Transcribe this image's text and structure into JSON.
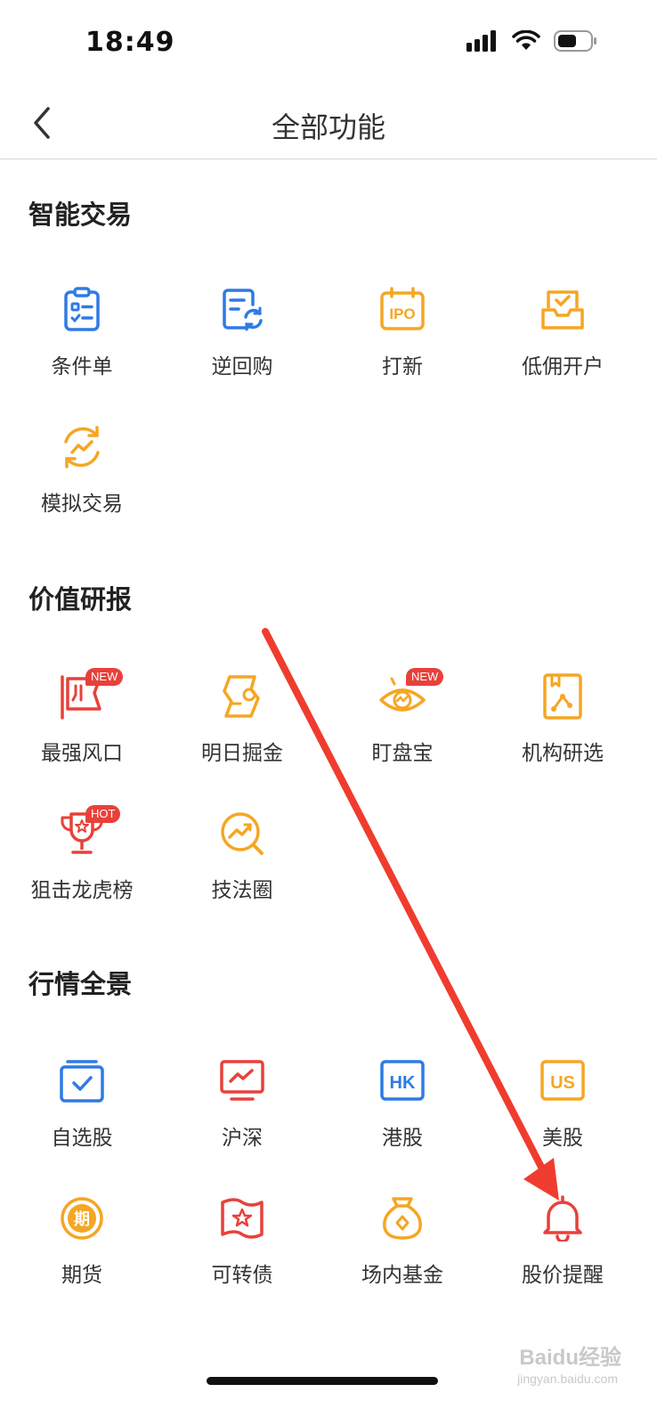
{
  "status": {
    "time": "18:49"
  },
  "header": {
    "title": "全部功能"
  },
  "sections": [
    {
      "title": "智能交易",
      "items": [
        {
          "label": "条件单",
          "icon": "clipboard-list-icon"
        },
        {
          "label": "逆回购",
          "icon": "document-refresh-icon"
        },
        {
          "label": "打新",
          "icon": "ipo-calendar-icon",
          "icon_text": "IPO"
        },
        {
          "label": "低佣开户",
          "icon": "open-account-icon"
        },
        {
          "label": "模拟交易",
          "icon": "simulated-trading-icon"
        }
      ]
    },
    {
      "title": "价值研报",
      "items": [
        {
          "label": "最强风口",
          "icon": "flag-icon",
          "badge": "NEW"
        },
        {
          "label": "明日掘金",
          "icon": "gold-coin-icon"
        },
        {
          "label": "盯盘宝",
          "icon": "eye-icon",
          "badge": "NEW"
        },
        {
          "label": "机构研选",
          "icon": "research-book-icon"
        },
        {
          "label": "狙击龙虎榜",
          "icon": "trophy-icon",
          "badge": "HOT"
        },
        {
          "label": "技法圈",
          "icon": "trend-magnifier-icon"
        }
      ]
    },
    {
      "title": "行情全景",
      "items": [
        {
          "label": "自选股",
          "icon": "watchlist-icon"
        },
        {
          "label": "沪深",
          "icon": "monitor-chart-icon"
        },
        {
          "label": "港股",
          "icon": "hk-icon",
          "icon_text": "HK"
        },
        {
          "label": "美股",
          "icon": "us-icon",
          "icon_text": "US"
        },
        {
          "label": "期货",
          "icon": "futures-icon",
          "icon_text": "期"
        },
        {
          "label": "可转债",
          "icon": "convertible-bond-icon"
        },
        {
          "label": "场内基金",
          "icon": "fund-bag-icon"
        },
        {
          "label": "股价提醒",
          "icon": "bell-icon"
        }
      ]
    }
  ],
  "colors": {
    "blue": "#2f7ae5",
    "orange": "#f5a623",
    "red": "#e8413a",
    "arrow": "#f03c2e"
  },
  "watermark": {
    "brand": "Baidu经验",
    "url": "jingyan.baidu.com"
  }
}
